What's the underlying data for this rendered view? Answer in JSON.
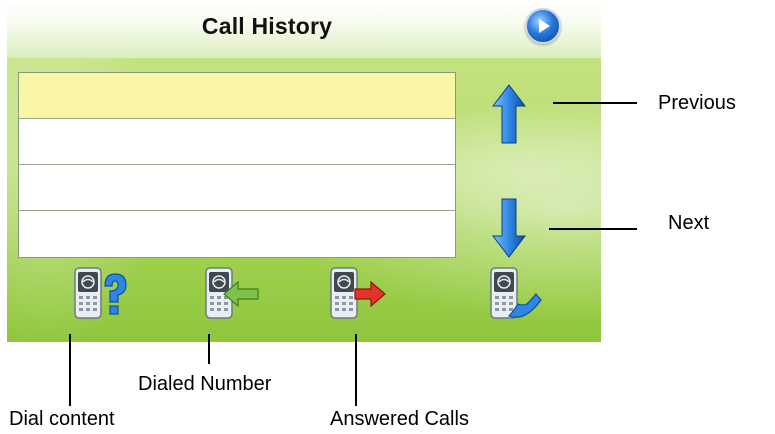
{
  "screen": {
    "title": "Call History",
    "list_rows": [
      "",
      "",
      "",
      ""
    ],
    "selected_row": 0
  },
  "annotations": {
    "previous": "Previous",
    "next": "Next",
    "dial_content": "Dial content",
    "dialed_number": "Dialed Number",
    "answered_calls": "Answered Calls"
  },
  "icons": {
    "play": "play-icon",
    "up": "arrow-up-icon",
    "down": "arrow-down-icon",
    "dial_content": "phone-question-icon",
    "dialed_number": "phone-green-arrow-icon",
    "answered_calls": "phone-red-arrow-icon",
    "call": "phone-handset-icon"
  },
  "colors": {
    "accent_blue": "#1f79d8",
    "selected_row": "#fbf6a6",
    "green_arrow": "#7fc24a",
    "red_arrow": "#e2342b"
  }
}
